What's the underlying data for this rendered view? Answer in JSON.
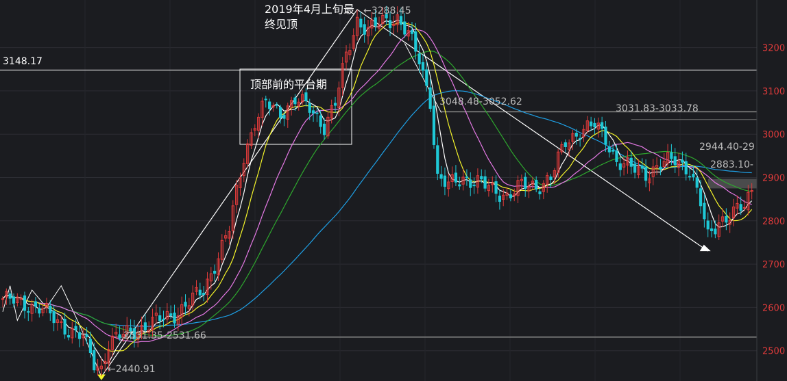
{
  "chart_data": {
    "type": "candlestick",
    "title": "",
    "ylim": [
      2430,
      3310
    ],
    "y_ticks": [
      2500,
      2600,
      2700,
      2800,
      2900,
      3000,
      3100,
      3200
    ],
    "grid": true,
    "colors": {
      "up": "#e03b3b",
      "down": "#1fc8d6",
      "ma5": "#ffffff",
      "ma10": "#f5f52a",
      "ma20": "#e67ae6",
      "ma30": "#2ea82e",
      "ma60": "#1ea0e6"
    },
    "key_lines": [
      {
        "label": "3148.17",
        "value": 3148.17,
        "color": "#ffffff"
      },
      {
        "value": 3052,
        "color": "#707070"
      },
      {
        "value": 3050,
        "color": "#707070"
      },
      {
        "value": 2531.5,
        "color": "#707070"
      }
    ],
    "texts": {
      "peak_note_line1": "2019年4月上旬最",
      "peak_note_line2": "终见顶",
      "platform_note": "顶部前的平台期",
      "peak_value": "←3288.45",
      "low_value": "←2440.91",
      "low_range": "2531.35-2531.66",
      "range_1": "3048.48-3052.62",
      "range_2": "3031.83-3033.78",
      "range_3": "2944.40-29",
      "range_4": "2883.10-"
    },
    "anchors": [
      {
        "x": 0,
        "y": 2620
      },
      {
        "x": 10,
        "y": 2600
      },
      {
        "x": 16,
        "y": 2560
      },
      {
        "x": 22,
        "y": 2530
      },
      {
        "x": 25,
        "y": 2470
      },
      {
        "x": 27,
        "y": 2460
      },
      {
        "x": 29,
        "y": 2520
      },
      {
        "x": 34,
        "y": 2540
      },
      {
        "x": 40,
        "y": 2560
      },
      {
        "x": 48,
        "y": 2590
      },
      {
        "x": 55,
        "y": 2640
      },
      {
        "x": 62,
        "y": 2780
      },
      {
        "x": 66,
        "y": 2950
      },
      {
        "x": 69,
        "y": 3030
      },
      {
        "x": 72,
        "y": 3070
      },
      {
        "x": 76,
        "y": 3050
      },
      {
        "x": 80,
        "y": 3080
      },
      {
        "x": 84,
        "y": 3060
      },
      {
        "x": 88,
        "y": 3020
      },
      {
        "x": 91,
        "y": 3070
      },
      {
        "x": 94,
        "y": 3180
      },
      {
        "x": 97,
        "y": 3265
      },
      {
        "x": 100,
        "y": 3240
      },
      {
        "x": 104,
        "y": 3260
      },
      {
        "x": 108,
        "y": 3270
      },
      {
        "x": 111,
        "y": 3230
      },
      {
        "x": 114,
        "y": 3170
      },
      {
        "x": 117,
        "y": 3080
      },
      {
        "x": 119,
        "y": 2900
      },
      {
        "x": 122,
        "y": 2880
      },
      {
        "x": 126,
        "y": 2900
      },
      {
        "x": 130,
        "y": 2890
      },
      {
        "x": 134,
        "y": 2870
      },
      {
        "x": 138,
        "y": 2860
      },
      {
        "x": 142,
        "y": 2880
      },
      {
        "x": 146,
        "y": 2880
      },
      {
        "x": 150,
        "y": 2900
      },
      {
        "x": 154,
        "y": 2980
      },
      {
        "x": 158,
        "y": 3010
      },
      {
        "x": 162,
        "y": 3020
      },
      {
        "x": 165,
        "y": 2990
      },
      {
        "x": 168,
        "y": 2940
      },
      {
        "x": 172,
        "y": 2920
      },
      {
        "x": 176,
        "y": 2910
      },
      {
        "x": 180,
        "y": 2930
      },
      {
        "x": 184,
        "y": 2940
      },
      {
        "x": 188,
        "y": 2920
      },
      {
        "x": 191,
        "y": 2840
      },
      {
        "x": 193,
        "y": 2760
      },
      {
        "x": 196,
        "y": 2800
      },
      {
        "x": 200,
        "y": 2820
      },
      {
        "x": 203,
        "y": 2830
      },
      {
        "x": 205,
        "y": 2870
      }
    ]
  }
}
